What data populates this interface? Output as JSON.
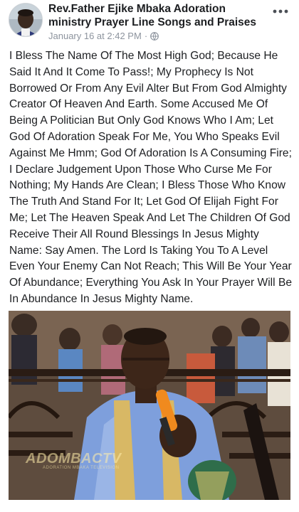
{
  "post": {
    "author": "Rev.Father Ejike Mbaka Adoration ministry Prayer Line Songs and Praises",
    "timestamp": "January 16 at 2:42 PM",
    "separator": "·",
    "privacy_icon": "globe-icon",
    "more_icon": "more-options-icon",
    "body": "I Bless The Name Of The Most High God; Because He Said It And It Come To Pass!; My Prophecy Is Not Borrowed Or From Any Evil Alter But From God Almighty Creator Of Heaven And Earth. Some Accused Me Of Being A Politician But Only God Knows Who I Am; Let God Of Adoration Speak For Me, You Who Speaks Evil Against Me Hmm; God Of Adoration Is A Consuming Fire; I Declare Judgement Upon Those Who Curse Me For Nothing; My Hands Are Clean; I Bless Those Who Know The Truth And Stand For It; Let God Of Elijah Fight For Me; Let The Heaven Speak And Let The Children Of God Receive Their All Round Blessings In Jesus Mighty Name: Say Amen. The Lord Is Taking You To A Level Even Your Enemy Can Not Reach; This Will Be Your Year Of Abundance; Everything You Ask In Your Prayer Will Be In Abundance In Jesus Mighty Name."
  },
  "photo": {
    "watermark": "ADOMBACTV",
    "watermark_sub": "ADORATION MBAKA TELEVISION"
  },
  "colors": {
    "text": "#1c1e21",
    "meta": "#8d949e",
    "background": "#ffffff"
  }
}
